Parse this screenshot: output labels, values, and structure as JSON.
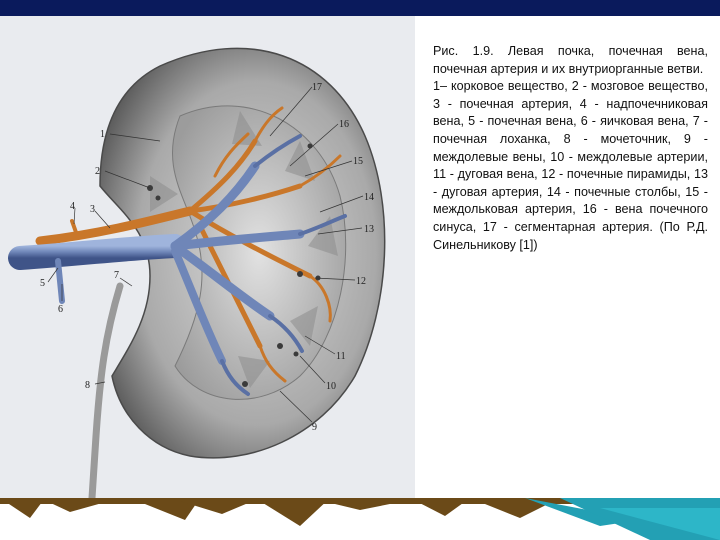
{
  "caption": {
    "title": "Рис. 1.9. Левая почка, почечная вена, почечная артерия и их внутриорганные ветви.",
    "legend": "1– корковое вещество, 2 - мозговое вещество, 3 - почечная артерия, 4 - надпочечниковая вена, 5 - почечная вена, 6 - яичковая вена, 7 - почечная лоханка, 8 - мочеточник, 9 - междолевые вены, 10 - междолевые артерии, 11 - дуговая вена, 12 - почечные пирамиды, 13 - дуговая артерия, 14 - почечные столбы, 15 - междольковая артерия, 16 - вена почечного синуса, 17 - сегментарная артерия. (По Р.Д. Синельникову [1])"
  },
  "figure": {
    "callouts": [
      "1",
      "2",
      "3",
      "4",
      "5",
      "6",
      "7",
      "8",
      "9",
      "10",
      "11",
      "12",
      "13",
      "14",
      "15",
      "16",
      "17"
    ]
  },
  "colors": {
    "top_bar": "#0a1a5c",
    "vein": "#6f86b8",
    "artery": "#c9772a",
    "footer_brown": "#6b4a18",
    "footer_teal": "#23a0b4"
  }
}
